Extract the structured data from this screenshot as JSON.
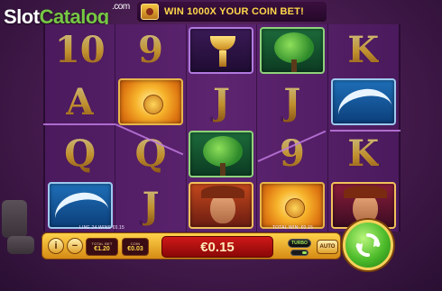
{
  "watermark": {
    "slot": "Slot",
    "catalog": "Catalog",
    "com": ".com"
  },
  "banner": {
    "text": "WIN 1000X YOUR COIN BET!",
    "icon": "treasure-icon"
  },
  "reels": {
    "cells": [
      {
        "type": "letter",
        "label": "10"
      },
      {
        "type": "letter",
        "label": "9"
      },
      {
        "type": "tile",
        "symbol": "goblet"
      },
      {
        "type": "tile",
        "symbol": "tree"
      },
      {
        "type": "letter",
        "label": "K"
      },
      {
        "type": "letter",
        "label": "A"
      },
      {
        "type": "tile",
        "symbol": "sun"
      },
      {
        "type": "letter",
        "label": "J"
      },
      {
        "type": "letter",
        "label": "J"
      },
      {
        "type": "tile",
        "symbol": "wave"
      },
      {
        "type": "letter",
        "label": "Q"
      },
      {
        "type": "letter",
        "label": "Q"
      },
      {
        "type": "tile",
        "symbol": "tree"
      },
      {
        "type": "letter",
        "label": "9"
      },
      {
        "type": "letter",
        "label": "K"
      },
      {
        "type": "tile",
        "symbol": "wave"
      },
      {
        "type": "letter",
        "label": "J"
      },
      {
        "type": "tile",
        "symbol": "woman"
      },
      {
        "type": "tile",
        "symbol": "sun"
      },
      {
        "type": "tile",
        "symbol": "woman-alt"
      }
    ]
  },
  "info": {
    "line_win": "LINE 24 WINS €0.15",
    "total_win": "TOTAL WIN: €0.15"
  },
  "controls": {
    "info_label": "i",
    "minus_label": "−",
    "plus_label": "+",
    "total_bet_label": "TOTAL BET",
    "total_bet_value": "€1.20",
    "coin_label": "COIN",
    "coin_value": "€0.03",
    "win_value": "€0.15",
    "turbo_label": "TURBO",
    "auto_label": "AUTO",
    "spin_icon": "refresh-arrows-icon"
  },
  "colors": {
    "accent_gold": "#f4c25a",
    "win_red": "#c21414",
    "spin_green": "#4cbb2a"
  }
}
